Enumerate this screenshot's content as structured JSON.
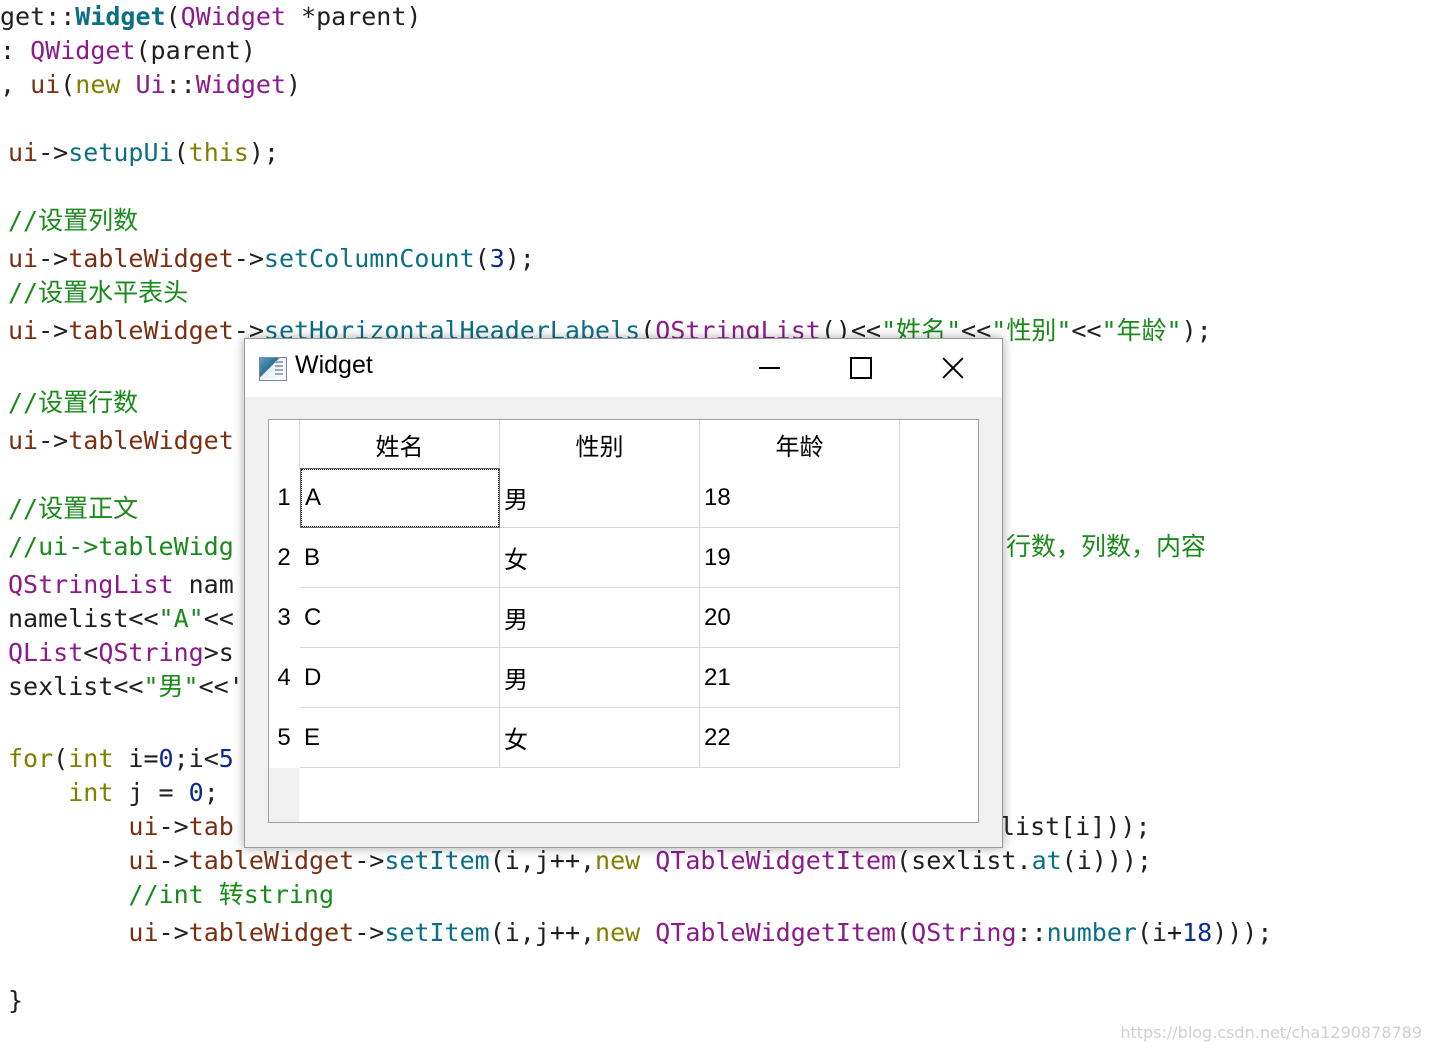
{
  "code": {
    "lines": [
      [
        {
          "t": "get::",
          "c": "t-dark"
        },
        {
          "t": "Widget",
          "c": "t-teal t-bold"
        },
        {
          "t": "(",
          "c": "t-dark"
        },
        {
          "t": "QWidget",
          "c": "t-purple"
        },
        {
          "t": " *parent)",
          "c": "t-dark"
        }
      ],
      [
        {
          "t": ": ",
          "c": "t-dark"
        },
        {
          "t": "QWidget",
          "c": "t-purple"
        },
        {
          "t": "(parent)",
          "c": "t-dark"
        }
      ],
      [
        {
          "t": ", ",
          "c": "t-dark"
        },
        {
          "t": "ui",
          "c": "t-brown"
        },
        {
          "t": "(",
          "c": "t-dark"
        },
        {
          "t": "new",
          "c": "t-olive"
        },
        {
          "t": " ",
          "c": "t-dark"
        },
        {
          "t": "Ui",
          "c": "t-purple"
        },
        {
          "t": "::",
          "c": "t-dark"
        },
        {
          "t": "Widget",
          "c": "t-purple"
        },
        {
          "t": ")",
          "c": "t-dark"
        }
      ],
      [
        {
          "t": "ui",
          "c": "t-brown"
        },
        {
          "t": "->",
          "c": "t-dark"
        },
        {
          "t": "setupUi",
          "c": "t-teal"
        },
        {
          "t": "(",
          "c": "t-dark"
        },
        {
          "t": "this",
          "c": "t-olive"
        },
        {
          "t": ");",
          "c": "t-dark"
        }
      ],
      [
        {
          "t": "//设置列数",
          "c": "t-green"
        }
      ],
      [
        {
          "t": "ui",
          "c": "t-brown"
        },
        {
          "t": "->",
          "c": "t-dark"
        },
        {
          "t": "tableWidget",
          "c": "t-brown"
        },
        {
          "t": "->",
          "c": "t-dark"
        },
        {
          "t": "setColumnCount",
          "c": "t-teal"
        },
        {
          "t": "(",
          "c": "t-dark"
        },
        {
          "t": "3",
          "c": "t-navy"
        },
        {
          "t": ");",
          "c": "t-dark"
        }
      ],
      [
        {
          "t": "//设置水平表头",
          "c": "t-green"
        }
      ],
      [
        {
          "t": "ui",
          "c": "t-brown"
        },
        {
          "t": "->",
          "c": "t-dark"
        },
        {
          "t": "tableWidget",
          "c": "t-brown"
        },
        {
          "t": "->",
          "c": "t-dark"
        },
        {
          "t": "setHorizontalHeaderLabels",
          "c": "t-teal t-under"
        },
        {
          "t": "(",
          "c": "t-dark"
        },
        {
          "t": "QStringList",
          "c": "t-purple t-under"
        },
        {
          "t": "()<<",
          "c": "t-dark"
        },
        {
          "t": "\"姓名\"",
          "c": "t-green"
        },
        {
          "t": "<<",
          "c": "t-dark"
        },
        {
          "t": "\"性别\"",
          "c": "t-green"
        },
        {
          "t": "<<",
          "c": "t-dark"
        },
        {
          "t": "\"年龄\"",
          "c": "t-green"
        },
        {
          "t": ");",
          "c": "t-dark"
        }
      ],
      [
        {
          "t": "//设置行数",
          "c": "t-green"
        }
      ],
      [
        {
          "t": "ui",
          "c": "t-brown"
        },
        {
          "t": "->",
          "c": "t-dark"
        },
        {
          "t": "tableWidget",
          "c": "t-brown"
        }
      ],
      [
        {
          "t": "//设置正文",
          "c": "t-green"
        }
      ],
      [
        {
          "t": "//ui->tableWidg",
          "c": "t-green"
        }
      ],
      [
        {
          "t": "行数，列数，内容",
          "c": "t-green"
        }
      ],
      [
        {
          "t": "QStringList",
          "c": "t-purple"
        },
        {
          "t": " nam",
          "c": "t-dark"
        }
      ],
      [
        {
          "t": "namelist",
          "c": "t-dark"
        },
        {
          "t": "<<",
          "c": "t-dark"
        },
        {
          "t": "\"A\"",
          "c": "t-green"
        },
        {
          "t": "<<",
          "c": "t-dark"
        }
      ],
      [
        {
          "t": "QList",
          "c": "t-purple"
        },
        {
          "t": "<",
          "c": "t-dark"
        },
        {
          "t": "QString",
          "c": "t-purple"
        },
        {
          "t": ">s",
          "c": "t-dark"
        }
      ],
      [
        {
          "t": "sexlist",
          "c": "t-dark"
        },
        {
          "t": "<<",
          "c": "t-dark"
        },
        {
          "t": "\"男\"",
          "c": "t-green"
        },
        {
          "t": "<<'",
          "c": "t-dark"
        }
      ],
      [
        {
          "t": "for",
          "c": "t-olive"
        },
        {
          "t": "(",
          "c": "t-dark"
        },
        {
          "t": "int",
          "c": "t-olive"
        },
        {
          "t": " i=",
          "c": "t-dark"
        },
        {
          "t": "0",
          "c": "t-navy"
        },
        {
          "t": ";i<",
          "c": "t-dark"
        },
        {
          "t": "5",
          "c": "t-navy"
        }
      ],
      [
        {
          "t": "    ",
          "c": "t-dark"
        },
        {
          "t": "int",
          "c": "t-olive"
        },
        {
          "t": " j = ",
          "c": "t-dark"
        },
        {
          "t": "0",
          "c": "t-navy"
        },
        {
          "t": ";",
          "c": "t-dark"
        }
      ],
      [
        {
          "t": "        ",
          "c": "t-dark"
        },
        {
          "t": "ui",
          "c": "t-brown"
        },
        {
          "t": "->",
          "c": "t-dark"
        },
        {
          "t": "tab",
          "c": "t-brown"
        }
      ],
      [
        {
          "t": "list[i]));",
          "c": "t-dark"
        }
      ],
      [
        {
          "t": "        ",
          "c": "t-dark"
        },
        {
          "t": "ui",
          "c": "t-brown"
        },
        {
          "t": "->",
          "c": "t-dark"
        },
        {
          "t": "tableWidget",
          "c": "t-brown"
        },
        {
          "t": "->",
          "c": "t-dark"
        },
        {
          "t": "setItem",
          "c": "t-teal"
        },
        {
          "t": "(i,j++,",
          "c": "t-dark"
        },
        {
          "t": "new",
          "c": "t-olive"
        },
        {
          "t": " ",
          "c": "t-dark"
        },
        {
          "t": "QTableWidgetItem",
          "c": "t-purple"
        },
        {
          "t": "(sexlist.",
          "c": "t-dark"
        },
        {
          "t": "at",
          "c": "t-teal"
        },
        {
          "t": "(i)));",
          "c": "t-dark"
        }
      ],
      [
        {
          "t": "        ",
          "c": "t-dark"
        },
        {
          "t": "//int 转string",
          "c": "t-green"
        }
      ],
      [
        {
          "t": "        ",
          "c": "t-dark"
        },
        {
          "t": "ui",
          "c": "t-brown"
        },
        {
          "t": "->",
          "c": "t-dark"
        },
        {
          "t": "tableWidget",
          "c": "t-brown"
        },
        {
          "t": "->",
          "c": "t-dark"
        },
        {
          "t": "setItem",
          "c": "t-teal"
        },
        {
          "t": "(i,j++,",
          "c": "t-dark"
        },
        {
          "t": "new",
          "c": "t-olive"
        },
        {
          "t": " ",
          "c": "t-dark"
        },
        {
          "t": "QTableWidgetItem",
          "c": "t-purple"
        },
        {
          "t": "(",
          "c": "t-dark"
        },
        {
          "t": "QString",
          "c": "t-purple"
        },
        {
          "t": "::",
          "c": "t-dark"
        },
        {
          "t": "number",
          "c": "t-teal"
        },
        {
          "t": "(i+",
          "c": "t-dark"
        },
        {
          "t": "18",
          "c": "t-navy"
        },
        {
          "t": ")));",
          "c": "t-dark"
        }
      ],
      [
        {
          "t": "}",
          "c": "t-dark"
        }
      ]
    ]
  },
  "window": {
    "title": "Widget",
    "icon": "app-window-icon",
    "controls": {
      "minimize": "minimize-icon",
      "maximize": "maximize-icon",
      "close": "close-icon"
    }
  },
  "table": {
    "headers": [
      "姓名",
      "性别",
      "年龄"
    ],
    "row_labels": [
      "1",
      "2",
      "3",
      "4",
      "5"
    ],
    "rows": [
      [
        "A",
        "男",
        "18"
      ],
      [
        "B",
        "女",
        "19"
      ],
      [
        "C",
        "男",
        "20"
      ],
      [
        "D",
        "男",
        "21"
      ],
      [
        "E",
        "女",
        "22"
      ]
    ]
  },
  "watermark": "https://blog.csdn.net/cha1290878789"
}
